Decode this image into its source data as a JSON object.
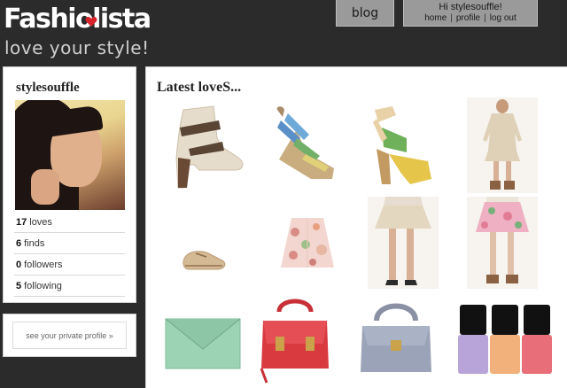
{
  "header": {
    "logo_text": "Fashiolista",
    "tagline": "love your style!",
    "blog_label": "blog",
    "greeting": "Hi stylesouffle!",
    "links": [
      "home",
      "profile",
      "log out"
    ]
  },
  "profile": {
    "username": "stylesouffle",
    "stats": [
      {
        "count": "17",
        "label": "loves"
      },
      {
        "count": "6",
        "label": "finds"
      },
      {
        "count": "0",
        "label": "followers"
      },
      {
        "count": "5",
        "label": "following"
      }
    ],
    "private_link": "see your private profile »"
  },
  "main": {
    "title": "Latest loveS...",
    "items": [
      {
        "name": "cream-ankle-boot"
      },
      {
        "name": "striped-wedge-sandal"
      },
      {
        "name": "yellow-green-platform-heel"
      },
      {
        "name": "cream-dress-outfit"
      },
      {
        "name": "tan-lace-up-shoe"
      },
      {
        "name": "floral-jacket"
      },
      {
        "name": "pleated-skirt-outfit"
      },
      {
        "name": "floral-skirt-outfit"
      },
      {
        "name": "mint-envelope-clutch"
      },
      {
        "name": "red-satchel-bag"
      },
      {
        "name": "grey-handbag"
      },
      {
        "name": "nail-polish-set"
      }
    ]
  },
  "colors": {
    "background": "#2b2b2b",
    "tab": "#9a9a9a",
    "heart": "#d8232a"
  }
}
